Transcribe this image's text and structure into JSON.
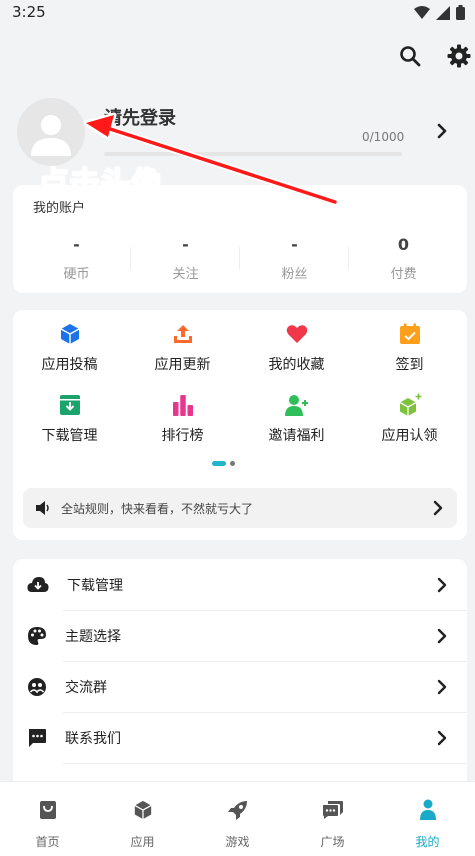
{
  "status_bar": {
    "time": "3:25"
  },
  "profile": {
    "login_prompt": "请先登录",
    "progress_text": "0/1000",
    "progress_fraction": 0
  },
  "annotation": {
    "text": "点击头像"
  },
  "account": {
    "label": "我的账户",
    "stats": [
      {
        "value": "-",
        "label": "硬币"
      },
      {
        "value": "-",
        "label": "关注"
      },
      {
        "value": "-",
        "label": "粉丝"
      },
      {
        "value": "0",
        "label": "付费"
      }
    ]
  },
  "features": [
    {
      "label": "应用投稿",
      "icon": "cube-icon",
      "color": "#1a73e8"
    },
    {
      "label": "应用更新",
      "icon": "upload-icon",
      "color": "#ff6a2b"
    },
    {
      "label": "我的收藏",
      "icon": "heart-icon",
      "color": "#f0384a"
    },
    {
      "label": "签到",
      "icon": "calendar-check-icon",
      "color": "#ff9f1a"
    },
    {
      "label": "下载管理",
      "icon": "download-box-icon",
      "color": "#1aa36b"
    },
    {
      "label": "排行榜",
      "icon": "bar-chart-icon",
      "color": "#e8368f"
    },
    {
      "label": "邀请福利",
      "icon": "add-user-icon",
      "color": "#2fbf5a"
    },
    {
      "label": "应用认领",
      "icon": "cube-plus-icon",
      "color": "#7cc23a"
    }
  ],
  "notice": {
    "text": "全站规则，快来看看，不然就亏大了",
    "icon": "speaker-icon"
  },
  "menu": [
    {
      "label": "下载管理",
      "icon": "cloud-download-icon"
    },
    {
      "label": "主题选择",
      "icon": "palette-icon"
    },
    {
      "label": "交流群",
      "icon": "group-icon"
    },
    {
      "label": "联系我们",
      "icon": "message-icon"
    }
  ],
  "bottom_nav": [
    {
      "label": "首页",
      "icon": "bag-icon",
      "active": false
    },
    {
      "label": "应用",
      "icon": "cube-icon",
      "active": false
    },
    {
      "label": "游戏",
      "icon": "rocket-icon",
      "active": false
    },
    {
      "label": "广场",
      "icon": "chat-icon",
      "active": false
    },
    {
      "label": "我的",
      "icon": "person-icon",
      "active": true
    }
  ],
  "colors": {
    "accent": "#1aa9c7",
    "annotation": "#ff1a1a"
  }
}
